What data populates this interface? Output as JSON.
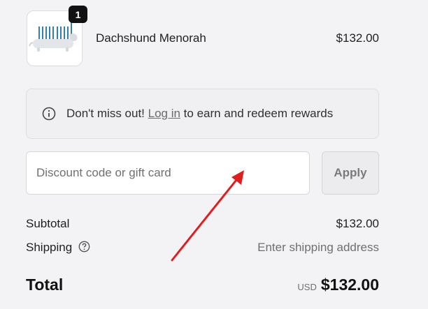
{
  "line_item": {
    "name": "Dachshund Menorah",
    "price": "$132.00",
    "quantity": "1",
    "thumbnail_icon": "dachshund-menorah-image"
  },
  "rewards_notice": {
    "icon": "info-icon",
    "text_before": "Don't miss out! ",
    "link_label": "Log in",
    "text_after": " to earn and redeem rewards"
  },
  "discount": {
    "placeholder": "Discount code or gift card",
    "value": "",
    "apply_label": "Apply"
  },
  "summary": {
    "subtotal_label": "Subtotal",
    "subtotal_value": "$132.00",
    "shipping_label": "Shipping",
    "shipping_help_icon": "question-circle-icon",
    "shipping_value": "Enter shipping address",
    "total_label": "Total",
    "total_currency": "USD",
    "total_value": "$132.00"
  },
  "annotation": {
    "icon": "red-arrow-icon",
    "color": "#e11d1d"
  },
  "colors": {
    "page_background": "#f3f3f5",
    "badge_background": "#111111",
    "apply_button_background": "#ececef"
  }
}
